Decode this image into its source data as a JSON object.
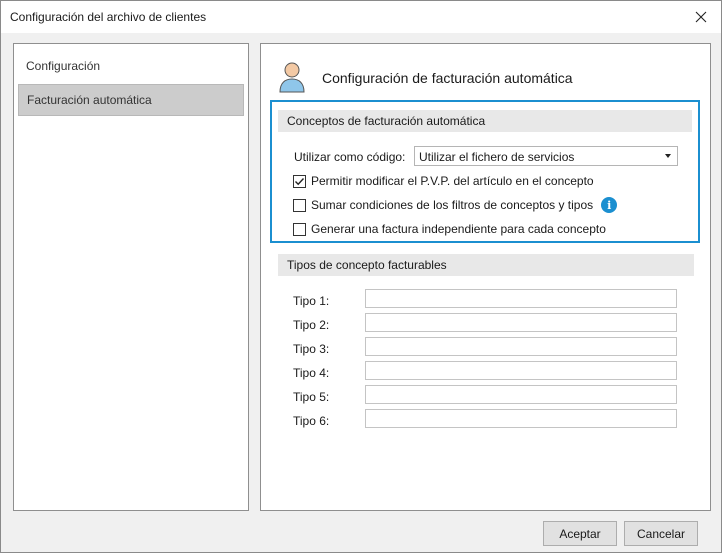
{
  "window": {
    "title": "Configuración del archivo de clientes"
  },
  "nav": {
    "items": [
      {
        "label": "Configuración",
        "selected": false
      },
      {
        "label": "Facturación automática",
        "selected": true
      }
    ]
  },
  "content": {
    "title": "Configuración de facturación automática",
    "conceptos": {
      "header": "Conceptos de facturación automática",
      "codigo_label": "Utilizar como código:",
      "codigo_value": "Utilizar el fichero de servicios",
      "checks": [
        {
          "label": "Permitir modificar el P.V.P. del artículo en el concepto",
          "checked": true
        },
        {
          "label": "Sumar condiciones de los filtros de conceptos y tipos",
          "checked": false,
          "info_icon": "info-icon"
        },
        {
          "label": "Generar una factura independiente para cada concepto",
          "checked": false
        }
      ]
    },
    "tipos": {
      "header": "Tipos de concepto facturables",
      "rows": [
        {
          "label": "Tipo 1:",
          "value": ""
        },
        {
          "label": "Tipo 2:",
          "value": ""
        },
        {
          "label": "Tipo 3:",
          "value": ""
        },
        {
          "label": "Tipo 4:",
          "value": ""
        },
        {
          "label": "Tipo 5:",
          "value": ""
        },
        {
          "label": "Tipo 6:",
          "value": ""
        }
      ]
    }
  },
  "buttons": {
    "accept": "Aceptar",
    "cancel": "Cancelar"
  },
  "colors": {
    "accent": "#1b8fd0",
    "selection": "#cccccc"
  }
}
